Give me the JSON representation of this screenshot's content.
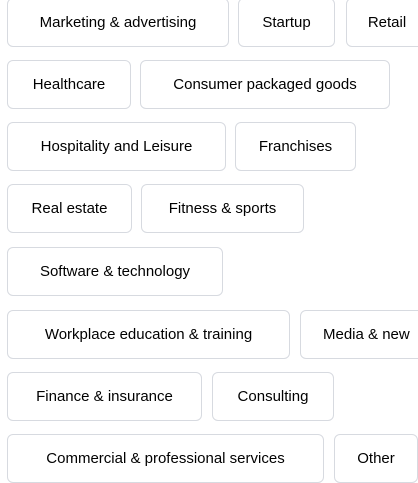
{
  "industry_chips": {
    "rows": [
      {
        "items": [
          {
            "label": "Marketing & advertising"
          },
          {
            "label": "Startup"
          },
          {
            "label": "Retail"
          }
        ]
      },
      {
        "items": [
          {
            "label": "Healthcare"
          },
          {
            "label": "Consumer packaged goods"
          }
        ]
      },
      {
        "items": [
          {
            "label": "Hospitality and Leisure"
          },
          {
            "label": "Franchises"
          }
        ]
      },
      {
        "items": [
          {
            "label": "Real estate"
          },
          {
            "label": "Fitness & sports"
          }
        ]
      },
      {
        "items": [
          {
            "label": "Software & technology"
          }
        ]
      },
      {
        "items": [
          {
            "label": "Workplace education & training"
          },
          {
            "label": "Media & new"
          }
        ]
      },
      {
        "items": [
          {
            "label": "Finance & insurance"
          },
          {
            "label": "Consulting"
          }
        ]
      },
      {
        "items": [
          {
            "label": "Commercial & professional services"
          },
          {
            "label": "Other"
          }
        ]
      }
    ]
  }
}
